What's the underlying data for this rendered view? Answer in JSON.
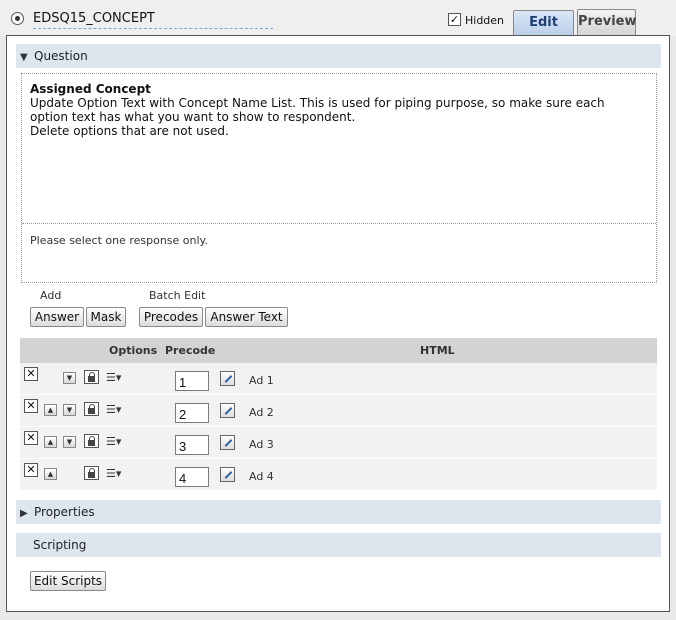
{
  "header": {
    "question_id": "EDSQ15_CONCEPT",
    "hidden_label": "Hidden",
    "hidden_checked": "✓",
    "tabs": [
      {
        "label": "Edit",
        "active": true
      },
      {
        "label": "Preview",
        "active": false
      }
    ]
  },
  "question_section": {
    "label": "Question",
    "title": "Assigned Concept",
    "body_lines": [
      "Update Option Text with Concept Name List. This is used for piping purpose, so make sure each",
      "option text has what you want to show to respondent.",
      "Delete options that are not used."
    ],
    "instruction": "Please select one response only."
  },
  "add_group": {
    "label": "Add",
    "answer_button": "Answer",
    "mask_button": "Mask"
  },
  "batch_group": {
    "label": "Batch Edit",
    "precodes_button": "Precodes",
    "answer_text_button": "Answer Text"
  },
  "options_table": {
    "columns": {
      "options": "Options",
      "precode": "Precode",
      "html": "HTML"
    },
    "rows": [
      {
        "precode": "1",
        "html": "Ad 1",
        "has_up": false,
        "has_down": true
      },
      {
        "precode": "2",
        "html": "Ad 2",
        "has_up": true,
        "has_down": true
      },
      {
        "precode": "3",
        "html": "Ad 3",
        "has_up": true,
        "has_down": true
      },
      {
        "precode": "4",
        "html": "Ad 4",
        "has_up": true,
        "has_down": false
      }
    ],
    "delete_symbol": "✕",
    "up_symbol": "▲",
    "down_symbol": "▼",
    "menu_symbol": "☰▾"
  },
  "properties_section": {
    "label": "Properties"
  },
  "scripting_section": {
    "label": "Scripting",
    "edit_button": "Edit Scripts"
  },
  "colors": {
    "section_bar": "#dde5ee",
    "table_header": "#d3d3d3",
    "row_bg": "#f2f2f2",
    "edit_tab_text": "#1d3f73"
  }
}
